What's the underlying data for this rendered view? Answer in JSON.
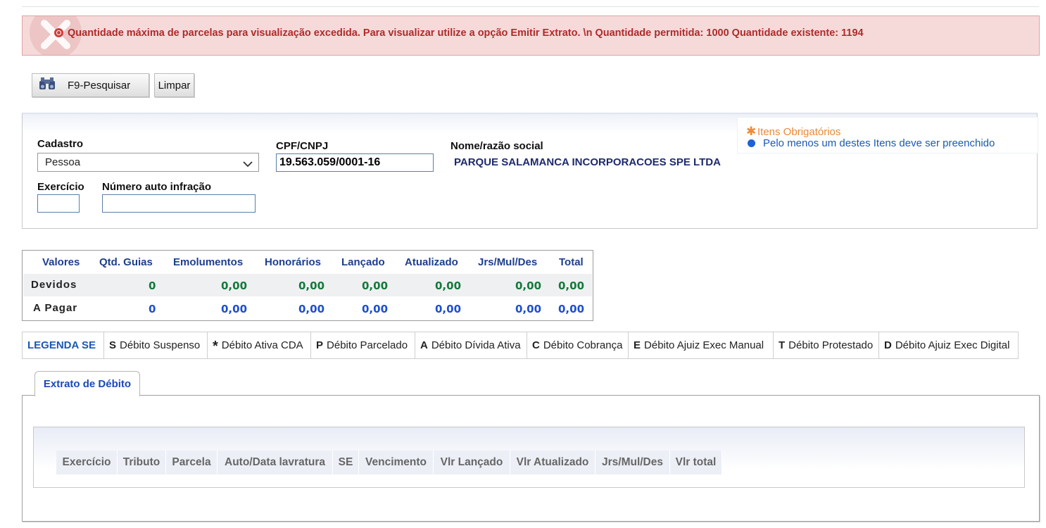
{
  "error": {
    "message": "Quantidade máxima de parcelas para visualização excedida. Para visualizar utilize a opção Emitir Extrato. \\n Quantidade permitida: 1000 Quantidade existente: 1194"
  },
  "toolbar": {
    "search_label": "F9-Pesquisar",
    "clear_label": "Limpar"
  },
  "form": {
    "cadastro_label": "Cadastro",
    "cadastro_value": "Pessoa",
    "cpf_label": "CPF/CNPJ",
    "cpf_value": "19.563.059/0001-16",
    "nome_label": "Nome/razão social",
    "nome_value": "PARQUE SALAMANCA INCORPORACOES SPE LTDA",
    "exercicio_label": "Exercício",
    "exercicio_value": "",
    "auto_label": "Número auto infração",
    "auto_value": ""
  },
  "legend": {
    "required": "Itens Obrigatórios",
    "at_least_one": "Pelo menos um destes Itens deve ser preenchido",
    "required_color": "#e88a3d",
    "at_least_one_color": "#1c58b5"
  },
  "values_table": {
    "headers": [
      "Valores",
      "Qtd. Guias",
      "Emolumentos",
      "Honorários",
      "Lançado",
      "Atualizado",
      "Jrs/Mul/Des",
      "Total"
    ],
    "rows": [
      {
        "label": "Devidos",
        "values": [
          "0",
          "0,00",
          "0,00",
          "0,00",
          "0,00",
          "0,00",
          "0,00"
        ]
      },
      {
        "label": "A Pagar",
        "values": [
          "0",
          "0,00",
          "0,00",
          "0,00",
          "0,00",
          "0,00",
          "0,00"
        ]
      }
    ]
  },
  "se_legend": {
    "title": "LEGENDA SE",
    "items": [
      {
        "code": "S",
        "label": "Débito Suspenso"
      },
      {
        "code": "*",
        "label": "Débito Ativa CDA"
      },
      {
        "code": "P",
        "label": "Débito Parcelado"
      },
      {
        "code": "A",
        "label": "Débito Dívida Ativa"
      },
      {
        "code": "C",
        "label": "Débito Cobrança"
      },
      {
        "code": "E",
        "label": "Débito Ajuiz Exec Manual"
      },
      {
        "code": "T",
        "label": "Débito Protestado"
      },
      {
        "code": "D",
        "label": "Débito Ajuiz Exec Digital"
      }
    ]
  },
  "tabs": [
    {
      "label": "Extrato de Débito"
    }
  ],
  "grid": {
    "headers": [
      "Exercício",
      "Tributo",
      "Parcela",
      "Auto/Data lavratura",
      "SE",
      "Vencimento",
      "Vlr Lançado",
      "Vlr Atualizado",
      "Jrs/Mul/Des",
      "Vlr total"
    ]
  }
}
